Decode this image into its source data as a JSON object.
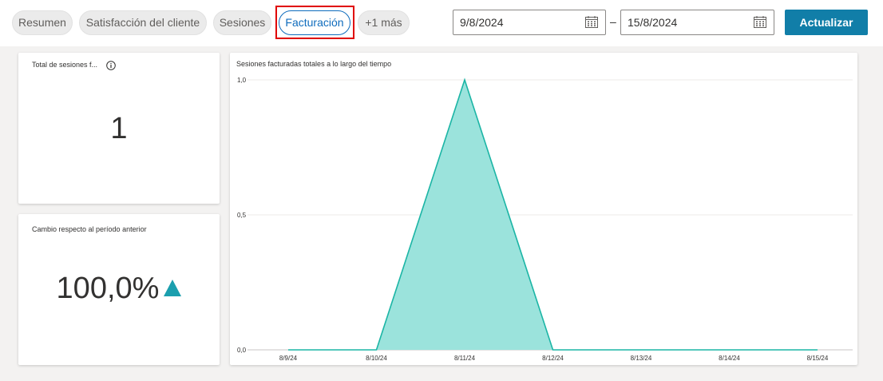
{
  "tabs": [
    {
      "label": "Resumen",
      "active": false
    },
    {
      "label": "Satisfacción del cliente",
      "active": false
    },
    {
      "label": "Sesiones",
      "active": false
    },
    {
      "label": "Facturación",
      "active": true
    },
    {
      "label": "+1 más",
      "active": false
    }
  ],
  "date_range": {
    "start": "9/8/2024",
    "separator": "–",
    "end": "15/8/2024"
  },
  "refresh_label": "Actualizar",
  "card_total": {
    "title": "Total de sesiones f...",
    "value": "1"
  },
  "card_change": {
    "title": "Cambio respecto al período anterior",
    "value": "100,0%",
    "trend": "up"
  },
  "chart_title": "Sesiones facturadas totales a lo largo del tiempo",
  "chart_data": {
    "type": "area",
    "title": "Sesiones facturadas totales a lo largo del tiempo",
    "x": [
      "8/9/24",
      "8/10/24",
      "8/11/24",
      "8/12/24",
      "8/13/24",
      "8/14/24",
      "8/15/24"
    ],
    "series": [
      {
        "values": [
          0,
          0,
          1,
          0,
          0,
          0,
          0
        ]
      }
    ],
    "yticks": [
      "0,0",
      "0,5",
      "1,0"
    ],
    "ylim": [
      0,
      1
    ],
    "grid": true,
    "color": "#1bb5a5",
    "fill": "#9be3dc"
  },
  "colors": {
    "accent": "#117ea8",
    "active_tab": "#0f6cbd",
    "trend_up": "#1b9fae"
  }
}
